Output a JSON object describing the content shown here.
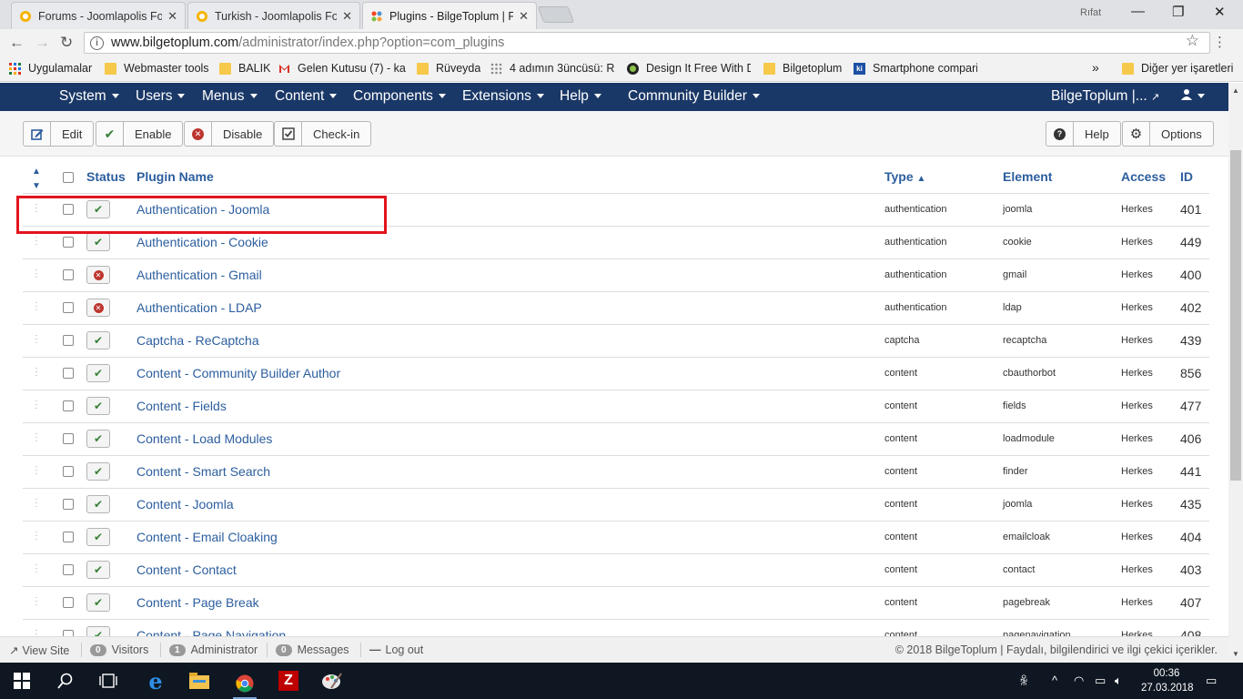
{
  "browser": {
    "tabs": [
      {
        "title": "Forums - Joomlapolis For",
        "active": false,
        "close": "✕"
      },
      {
        "title": "Turkish - Joomlapolis Fo",
        "active": false,
        "close": "✕"
      },
      {
        "title": "Plugins - BilgeToplum | F",
        "active": true,
        "close": "✕"
      }
    ],
    "user": "Rıfat",
    "url_domain": "www.bilgetoplum.com",
    "url_path": "/administrator/index.php?option=com_plugins",
    "bookmarks": [
      "Uygulamalar",
      "Webmaster tools",
      "BALIK",
      "Gelen Kutusu (7) - ka",
      "Rüveyda",
      "4 adımın 3üncüsü: Re",
      "Design It Free With D",
      "Bilgetoplum",
      "Smartphone compari"
    ],
    "more_bookmarks": "»",
    "other_bookmarks": "Diğer yer işaretleri"
  },
  "nav": {
    "menus": [
      "System",
      "Users",
      "Menus",
      "Content",
      "Components",
      "Extensions",
      "Help",
      "Community Builder"
    ],
    "site": "BilgeToplum |...",
    "user_icon": "user-icon"
  },
  "toolbar": {
    "edit": "Edit",
    "enable": "Enable",
    "disable": "Disable",
    "checkin": "Check-in",
    "help": "Help",
    "options": "Options"
  },
  "table": {
    "headers": {
      "status": "Status",
      "name": "Plugin Name",
      "type": "Type",
      "element": "Element",
      "access": "Access",
      "id": "ID"
    },
    "rows": [
      {
        "status": "enabled",
        "name": "Authentication - Joomla",
        "type": "authentication",
        "element": "joomla",
        "access": "Herkes",
        "id": "401"
      },
      {
        "status": "enabled",
        "name": "Authentication - Cookie",
        "type": "authentication",
        "element": "cookie",
        "access": "Herkes",
        "id": "449"
      },
      {
        "status": "disabled",
        "name": "Authentication - Gmail",
        "type": "authentication",
        "element": "gmail",
        "access": "Herkes",
        "id": "400"
      },
      {
        "status": "disabled",
        "name": "Authentication - LDAP",
        "type": "authentication",
        "element": "ldap",
        "access": "Herkes",
        "id": "402"
      },
      {
        "status": "enabled",
        "name": "Captcha - ReCaptcha",
        "type": "captcha",
        "element": "recaptcha",
        "access": "Herkes",
        "id": "439"
      },
      {
        "status": "enabled",
        "name": "Content - Community Builder Author",
        "type": "content",
        "element": "cbauthorbot",
        "access": "Herkes",
        "id": "856"
      },
      {
        "status": "enabled",
        "name": "Content - Fields",
        "type": "content",
        "element": "fields",
        "access": "Herkes",
        "id": "477"
      },
      {
        "status": "enabled",
        "name": "Content - Load Modules",
        "type": "content",
        "element": "loadmodule",
        "access": "Herkes",
        "id": "406"
      },
      {
        "status": "enabled",
        "name": "Content - Smart Search",
        "type": "content",
        "element": "finder",
        "access": "Herkes",
        "id": "441"
      },
      {
        "status": "enabled",
        "name": "Content - Joomla",
        "type": "content",
        "element": "joomla",
        "access": "Herkes",
        "id": "435"
      },
      {
        "status": "enabled",
        "name": "Content - Email Cloaking",
        "type": "content",
        "element": "emailcloak",
        "access": "Herkes",
        "id": "404"
      },
      {
        "status": "enabled",
        "name": "Content - Contact",
        "type": "content",
        "element": "contact",
        "access": "Herkes",
        "id": "403"
      },
      {
        "status": "enabled",
        "name": "Content - Page Break",
        "type": "content",
        "element": "pagebreak",
        "access": "Herkes",
        "id": "407"
      },
      {
        "status": "enabled",
        "name": "Content - Page Navigation",
        "type": "content",
        "element": "pagenavigation",
        "access": "Herkes",
        "id": "408"
      }
    ]
  },
  "footer": {
    "view_site": "View Site",
    "visitors_count": "0",
    "visitors": "Visitors",
    "admin_count": "1",
    "admin": "Administrator",
    "messages_count": "0",
    "messages": "Messages",
    "logout": "Log out",
    "copyright": "© 2018 BilgeToplum | Faydalı, bilgilendirici ve ilgi çekici içerikler."
  },
  "taskbar": {
    "time": "00:36",
    "date": "27.03.2018"
  },
  "colors": {
    "navbar": "#1a3867",
    "link": "#2c5e9e",
    "enabled": "#378137",
    "disabled": "#bd362f",
    "highlight": "#e3131d"
  }
}
